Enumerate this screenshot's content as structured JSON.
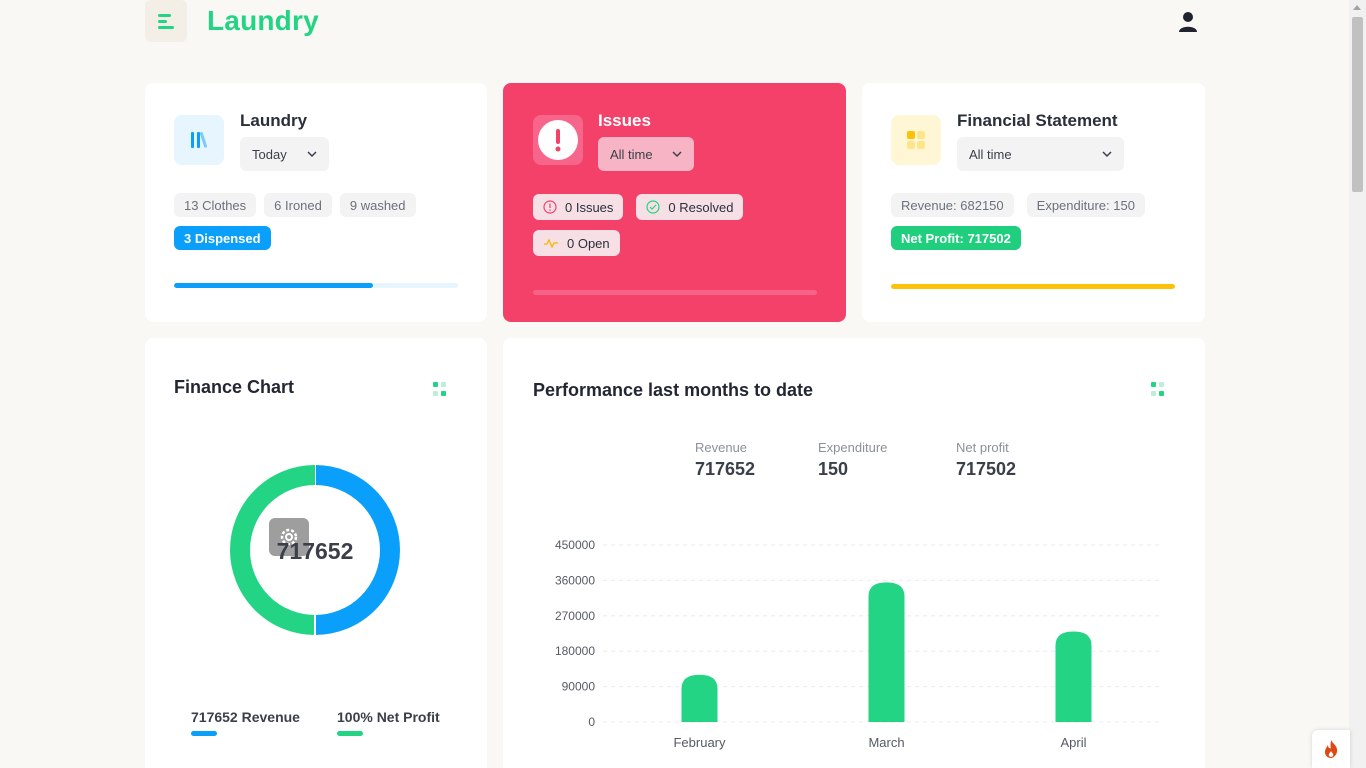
{
  "header": {
    "brand": "Laundry",
    "menu_icon": "menu-icon",
    "user_icon": "user-icon"
  },
  "colors": {
    "accent": "#22d483",
    "blue": "#0a9ffa",
    "pink": "#f3416a",
    "yellow": "#ffc107"
  },
  "cards": {
    "laundry": {
      "title": "Laundry",
      "select": "Today",
      "icon": "books-icon",
      "chips": [
        "13 Clothes",
        "6 Ironed",
        "9 washed"
      ],
      "dispensed": "3 Dispensed",
      "progress": 0.7
    },
    "issues": {
      "title": "Issues",
      "select": "All time",
      "icon": "alert-icon",
      "chips": {
        "issues": "0 Issues",
        "resolved": "0 Resolved",
        "open": "0 Open"
      },
      "progress": 0
    },
    "financial": {
      "title": "Financial Statement",
      "select": "All time",
      "icon": "grid-icon",
      "revenue": "Revenue: 682150",
      "expenditure": "Expenditure: 150",
      "net_profit": "Net Profit: 717502",
      "progress": 1.0
    }
  },
  "finance_chart": {
    "title": "Finance Chart",
    "center_value": "717652",
    "legend": [
      {
        "label": "717652 Revenue",
        "color": "#0a9ffa"
      },
      {
        "label": "100% Net Profit",
        "color": "#22d483"
      }
    ]
  },
  "performance": {
    "title": "Performance last months to date",
    "stats": [
      {
        "label": "Revenue",
        "value": "717652"
      },
      {
        "label": "Expenditure",
        "value": "150"
      },
      {
        "label": "Net profit",
        "value": "717502"
      }
    ]
  },
  "chart_data": [
    {
      "type": "pie",
      "title": "Finance Chart",
      "categories": [
        "Revenue",
        "Net Profit"
      ],
      "values": [
        50,
        50
      ],
      "colors": [
        "#0a9ffa",
        "#22d483"
      ]
    },
    {
      "type": "bar",
      "title": "Performance last months to date",
      "categories": [
        "February",
        "March",
        "April"
      ],
      "values": [
        120000,
        355000,
        230000
      ],
      "ylim": [
        0,
        450000
      ],
      "yticks": [
        "450000",
        "360000",
        "270000",
        "180000",
        "90000",
        "0"
      ],
      "grid": true,
      "color": "#22d483"
    }
  ]
}
